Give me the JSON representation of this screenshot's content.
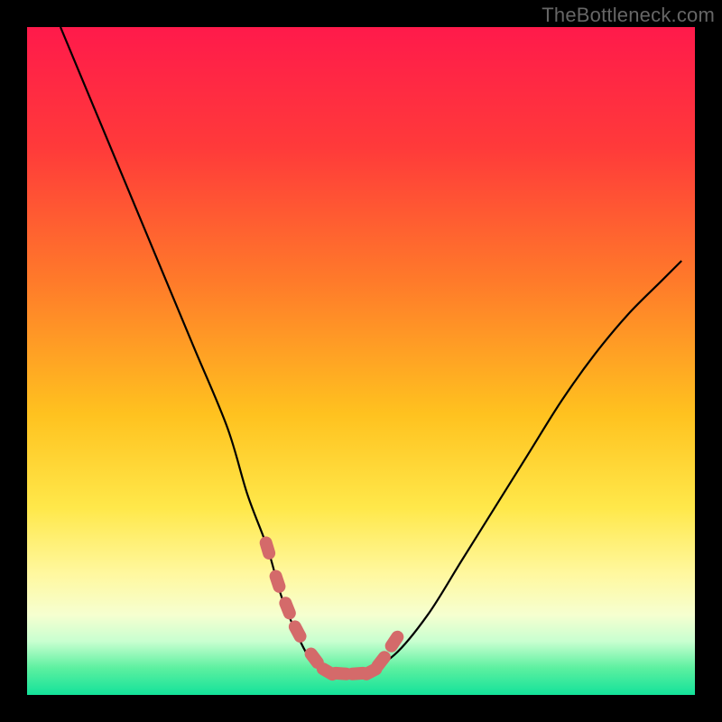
{
  "watermark": "TheBottleneck.com",
  "colors": {
    "frame_bg": "#000000",
    "gradient_stops": [
      {
        "pct": 0,
        "color": "#ff1a4b"
      },
      {
        "pct": 18,
        "color": "#ff3a3a"
      },
      {
        "pct": 38,
        "color": "#ff7a2a"
      },
      {
        "pct": 58,
        "color": "#ffc21f"
      },
      {
        "pct": 72,
        "color": "#ffe84a"
      },
      {
        "pct": 82,
        "color": "#fff8a0"
      },
      {
        "pct": 88,
        "color": "#f6ffd0"
      },
      {
        "pct": 92,
        "color": "#c8ffd0"
      },
      {
        "pct": 96,
        "color": "#5cf0a0"
      },
      {
        "pct": 100,
        "color": "#13e29a"
      }
    ],
    "curve_stroke": "#000000",
    "marker_fill": "#d46a6a"
  },
  "chart_data": {
    "type": "line",
    "title": "",
    "xlabel": "",
    "ylabel": "",
    "xlim": [
      0,
      100
    ],
    "ylim": [
      0,
      100
    ],
    "grid": false,
    "legend": false,
    "series": [
      {
        "name": "bottleneck-curve",
        "x": [
          5,
          10,
          15,
          20,
          25,
          30,
          33,
          36,
          38,
          40,
          42,
          44,
          46,
          48,
          50,
          55,
          60,
          65,
          70,
          75,
          80,
          85,
          90,
          95,
          98
        ],
        "values": [
          100,
          88,
          76,
          64,
          52,
          40,
          30,
          22,
          15,
          10,
          6,
          4,
          3,
          3,
          3,
          6,
          12,
          20,
          28,
          36,
          44,
          51,
          57,
          62,
          65
        ]
      }
    ],
    "markers": {
      "name": "optimal-range-markers",
      "x": [
        36,
        37.5,
        39,
        40.5,
        43,
        45,
        47,
        49.5,
        51.5,
        53,
        55
      ],
      "values": [
        22,
        17,
        13,
        9.5,
        5.5,
        3.5,
        3.2,
        3.2,
        3.5,
        5,
        8
      ]
    },
    "annotations": []
  }
}
